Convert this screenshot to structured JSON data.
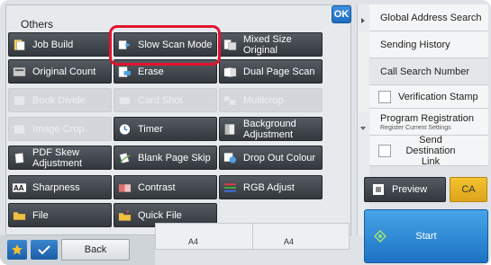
{
  "panel": {
    "title": "Others",
    "ok_label": "OK"
  },
  "functions": [
    {
      "label": "Job Build",
      "icon": "job-build-icon",
      "enabled": true
    },
    {
      "label": "Slow Scan Mode",
      "icon": "slow-scan-icon",
      "enabled": true,
      "selected": true
    },
    {
      "label": "Mixed Size Original",
      "icon": "mixed-size-icon",
      "enabled": true
    },
    {
      "label": "Original Count",
      "icon": "original-count-icon",
      "enabled": true
    },
    {
      "label": "Erase",
      "icon": "erase-icon",
      "enabled": true
    },
    {
      "label": "Dual Page Scan",
      "icon": "dual-page-icon",
      "enabled": true
    },
    {
      "label": "Book Divide",
      "icon": "book-divide-icon",
      "enabled": false
    },
    {
      "label": "Card Shot",
      "icon": "card-shot-icon",
      "enabled": false
    },
    {
      "label": "Multicrop",
      "icon": "multicrop-icon",
      "enabled": false
    },
    {
      "label": "Image Crop",
      "icon": "image-crop-icon",
      "enabled": false
    },
    {
      "label": "Timer",
      "icon": "timer-icon",
      "enabled": true
    },
    {
      "label": "Background Adjustment",
      "icon": "background-icon",
      "enabled": true
    },
    {
      "label": "PDF Skew Adjustment",
      "icon": "pdf-skew-icon",
      "enabled": true
    },
    {
      "label": "Blank Page Skip",
      "icon": "blank-page-icon",
      "enabled": true
    },
    {
      "label": "Drop Out Colour",
      "icon": "drop-out-icon",
      "enabled": true
    },
    {
      "label": "Sharpness",
      "icon": "sharpness-icon",
      "enabled": true
    },
    {
      "label": "Contrast",
      "icon": "contrast-icon",
      "enabled": true
    },
    {
      "label": "RGB Adjust",
      "icon": "rgb-icon",
      "enabled": true
    },
    {
      "label": "File",
      "icon": "file-icon",
      "enabled": true
    },
    {
      "label": "Quick File",
      "icon": "quick-file-icon",
      "enabled": true
    }
  ],
  "paper": {
    "left": "A4",
    "right": "A4"
  },
  "bottom": {
    "back_label": "Back"
  },
  "side": {
    "global_address": "Global Address Search",
    "sending_history": "Sending History",
    "call_search": "Call Search Number",
    "verification": "Verification Stamp",
    "program_registration": "Program Registration",
    "program_sub": "Register Current Settings",
    "send_destination": "Send Destination Link"
  },
  "actions": {
    "preview_label": "Preview",
    "ca_label": "CA",
    "start_label": "Start"
  },
  "colors": {
    "accent_blue": "#1f6cc0",
    "highlight_red": "#e3142e",
    "ca_yellow": "#f2c331",
    "button_dark": "#3b4046"
  }
}
